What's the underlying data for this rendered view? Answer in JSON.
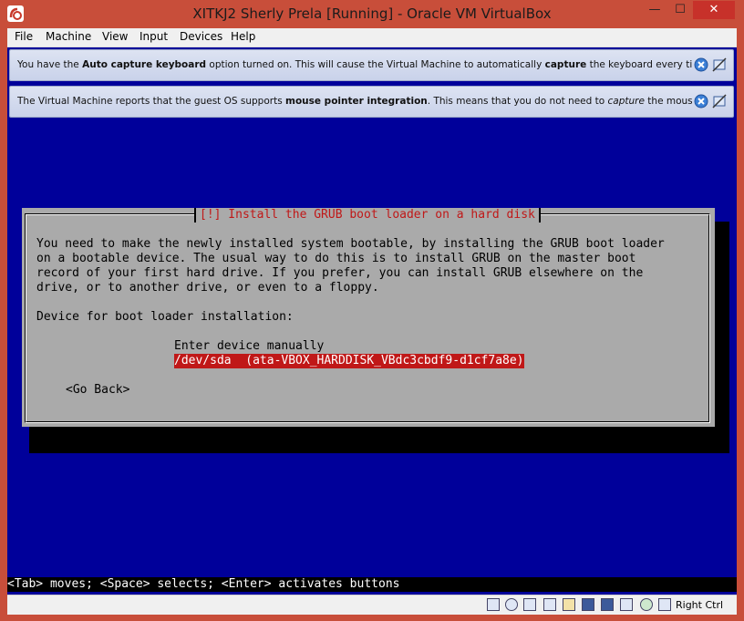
{
  "window": {
    "title": "XITKJ2 Sherly Prela [Running] - Oracle VM VirtualBox",
    "min_glyph": "—",
    "max_glyph": "☐",
    "close_glyph": "✕"
  },
  "menubar": [
    "File",
    "Machine",
    "View",
    "Input",
    "Devices",
    "Help"
  ],
  "notifications": [
    {
      "parts": [
        {
          "t": "You have the ",
          "s": "n"
        },
        {
          "t": "Auto capture keyboard",
          "s": "b"
        },
        {
          "t": " option turned on. This will cause the Virtual Machine to automatically ",
          "s": "n"
        },
        {
          "t": "capture",
          "s": "b"
        },
        {
          "t": " the keyboard every time the VM",
          "s": "n"
        }
      ]
    },
    {
      "parts": [
        {
          "t": "The Virtual Machine reports that the guest OS supports ",
          "s": "n"
        },
        {
          "t": "mouse pointer integration",
          "s": "b"
        },
        {
          "t": ". This means that you do not need to ",
          "s": "n"
        },
        {
          "t": "capture",
          "s": "i"
        },
        {
          "t": " the mouse pointer",
          "s": "n"
        }
      ]
    }
  ],
  "dialog": {
    "title": "[!] Install the GRUB boot loader on a hard disk",
    "body": [
      "You need to make the newly installed system bootable, by installing the GRUB boot loader",
      "on a bootable device. The usual way to do this is to install GRUB on the master boot",
      "record of your first hard drive. If you prefer, you can install GRUB elsewhere on the",
      "drive, or to another drive, or even to a floppy."
    ],
    "prompt": "Device for boot loader installation:",
    "options": [
      "Enter device manually",
      "/dev/sda  (ata-VBOX_HARDDISK_VBdc3cbdf9-d1cf7a8e)"
    ],
    "selected_index": 1,
    "back_label": "<Go Back>"
  },
  "status_line": "<Tab> moves; <Space> selects; <Enter> activates buttons",
  "statusbar": {
    "icons": [
      "hard-disk-icon",
      "optical-drive-icon",
      "floppy-icon",
      "usb-icon",
      "shared-folder-icon",
      "display-icon",
      "video-capture-icon",
      "network-icon",
      "mouse-integration-icon",
      "keyboard-capture-icon"
    ],
    "host_key": "Right Ctrl"
  },
  "colors": {
    "window_frame": "#c84e3a",
    "guest_background": "#00009a",
    "dialog_background": "#aaaaaa",
    "dialog_title": "#c01818",
    "selection": "#c01818"
  }
}
